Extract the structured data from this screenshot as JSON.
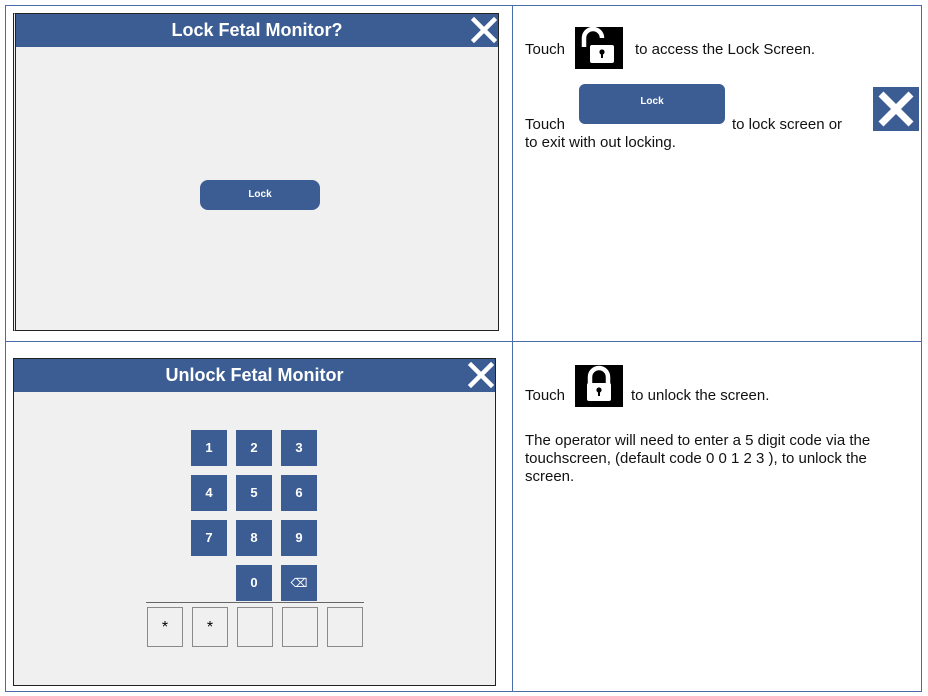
{
  "lock_screen": {
    "title": "Lock Fetal Monitor?",
    "lock_button": "Lock"
  },
  "unlock_screen": {
    "title": "Unlock Fetal Monitor",
    "keys": [
      "1",
      "2",
      "3",
      "4",
      "5",
      "6",
      "7",
      "8",
      "9",
      "0"
    ],
    "backspace_symbol": "⌫",
    "code_entries": [
      "*",
      "*",
      "",
      "",
      ""
    ]
  },
  "instructions_lock": {
    "line1_prefix": "Touch",
    "line1_suffix": "to access the Lock Screen.",
    "line2_prefix": "Touch",
    "line2_button": "Lock",
    "line2_middle": "to lock screen or",
    "line2_end": "to exit with out locking."
  },
  "instructions_unlock": {
    "line1_prefix": "Touch",
    "line1_suffix": "to unlock the screen.",
    "paragraph": "The operator will need to enter a 5 digit code via the touchscreen, (default code 0 0 1 2 3 ), to unlock the screen."
  },
  "colors": {
    "header_blue": "#3b5d94",
    "screen_bg": "#f0f0f0",
    "rule_blue": "#4a6ca8"
  }
}
